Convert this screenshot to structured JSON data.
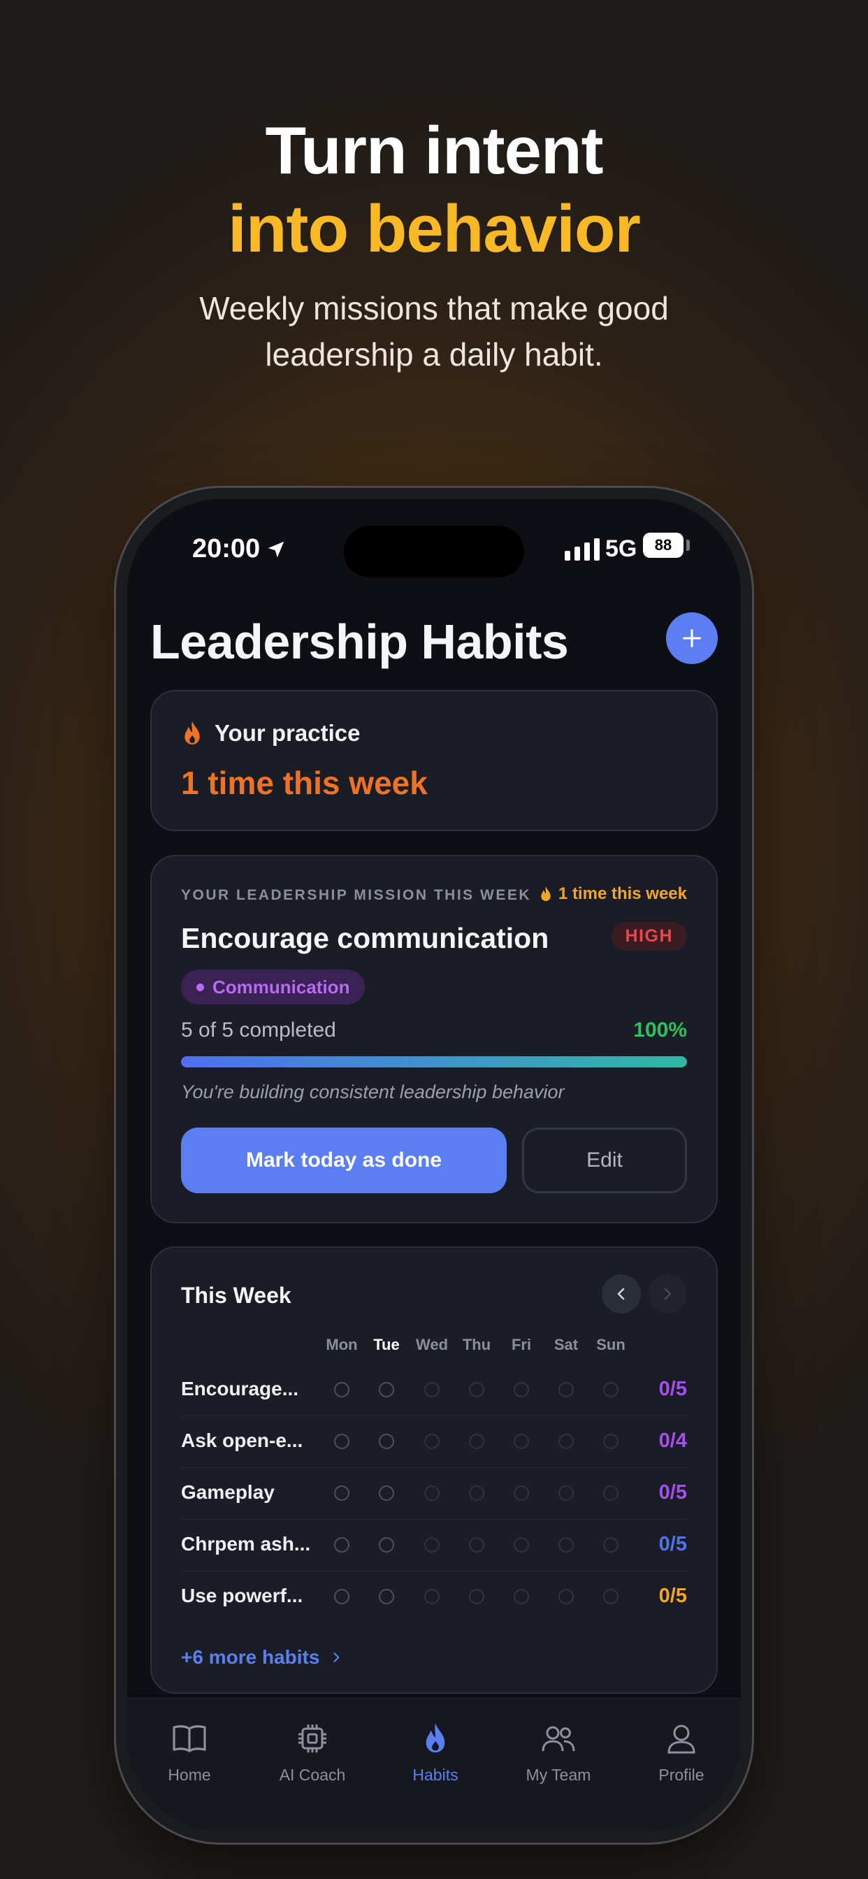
{
  "hero": {
    "title_line1": "Turn intent",
    "title_line2": "into behavior",
    "subtitle": "Weekly missions that make good leadership a daily habit."
  },
  "status_bar": {
    "time": "20:00",
    "network": "5G",
    "battery": "88"
  },
  "header": {
    "title": "Leadership Habits"
  },
  "practice": {
    "label": "Your practice",
    "count_text": "1 time this week"
  },
  "mission": {
    "eyebrow": "YOUR LEADERSHIP MISSION THIS WEEK",
    "streak": "1 time this week",
    "title": "Encourage communication",
    "priority": "HIGH",
    "tag": "Communication",
    "progress_text": "5 of 5 completed",
    "progress_percent": "100%",
    "progress_fraction": 1.0,
    "note": "You're building consistent leadership behavior",
    "done_label": "Mark today as done",
    "edit_label": "Edit"
  },
  "week": {
    "title": "This Week",
    "days": [
      "Mon",
      "Tue",
      "Wed",
      "Thu",
      "Fri",
      "Sat",
      "Sun"
    ],
    "today": "Tue",
    "habits": [
      {
        "name": "Encourage...",
        "score": "0/5",
        "color": "#a64ff0"
      },
      {
        "name": "Ask open-e...",
        "score": "0/4",
        "color": "#a64ff0"
      },
      {
        "name": "Gameplay",
        "score": "0/5",
        "color": "#a64ff0"
      },
      {
        "name": "Chrpem ash...",
        "score": "0/5",
        "color": "#4f73e8"
      },
      {
        "name": "Use powerf...",
        "score": "0/5",
        "color": "#f5a524"
      }
    ],
    "more": "+6 more habits"
  },
  "tabs": [
    {
      "label": "Home",
      "icon": "book-icon"
    },
    {
      "label": "AI Coach",
      "icon": "chip-icon"
    },
    {
      "label": "Habits",
      "icon": "flame-icon",
      "active": true
    },
    {
      "label": "My Team",
      "icon": "team-icon"
    },
    {
      "label": "Profile",
      "icon": "person-icon"
    }
  ],
  "colors": {
    "accent": "#5b7ff2",
    "hero_highlight": "#f9b824",
    "streak_orange": "#f07325",
    "success": "#2fbf63"
  }
}
